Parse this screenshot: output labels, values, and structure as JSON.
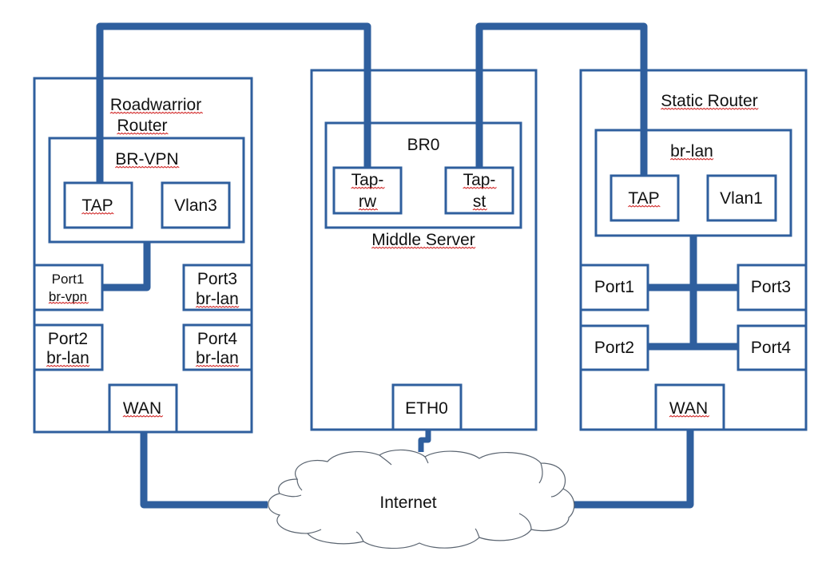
{
  "diagram": {
    "colors": {
      "line": "#2f5f9e",
      "text": "#111111",
      "spellcheck": "#d02020"
    },
    "roadwarrior": {
      "title_line1": "Roadwarrior",
      "title_line2": "Router",
      "bridge": "BR-VPN",
      "tap": "TAP",
      "vlan": "Vlan3",
      "ports": [
        {
          "name": "Port1",
          "bridge": "br-vpn"
        },
        {
          "name": "Port2",
          "bridge": "br-lan"
        },
        {
          "name": "Port3",
          "bridge": "br-lan"
        },
        {
          "name": "Port4",
          "bridge": "br-lan"
        }
      ],
      "wan": "WAN"
    },
    "middle": {
      "title": "Middle Server",
      "bridge": "BR0",
      "tap_rw_line1": "Tap-",
      "tap_rw_line2": "rw",
      "tap_st_line1": "Tap-",
      "tap_st_line2": "st",
      "eth": "ETH0"
    },
    "static": {
      "title": "Static Router",
      "bridge": "br-lan",
      "tap": "TAP",
      "vlan": "Vlan1",
      "ports": [
        "Port1",
        "Port2",
        "Port3",
        "Port4"
      ],
      "wan": "WAN"
    },
    "internet": "Internet"
  }
}
